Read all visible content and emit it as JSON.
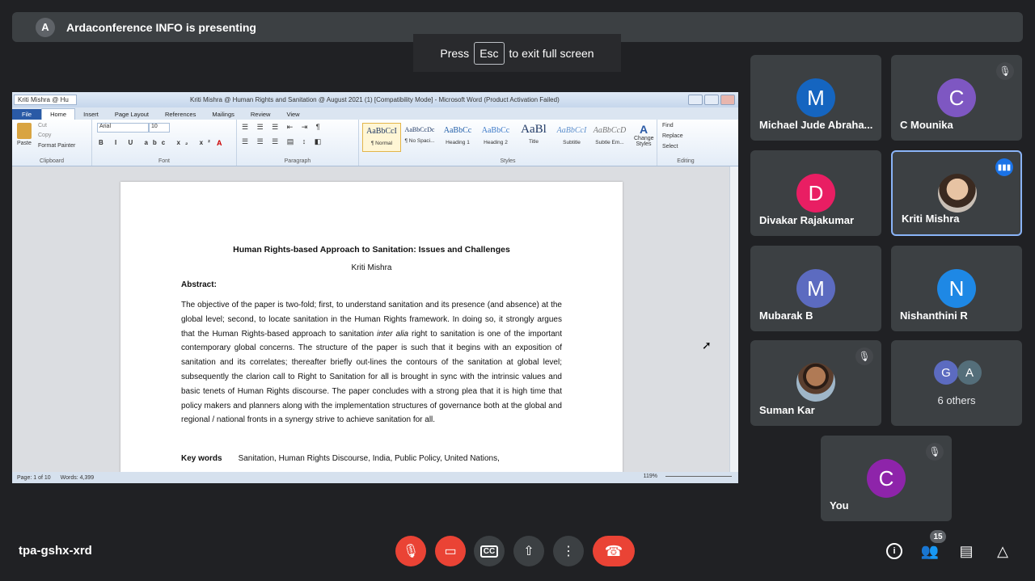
{
  "banner": {
    "avatar_letter": "A",
    "text": "Ardaconference INFO is presenting"
  },
  "fullscreen_hint": {
    "before": "Press",
    "key": "Esc",
    "after": "to exit full screen"
  },
  "word": {
    "doc_tab": "Kriti Mishra @ Hu",
    "title": "Kriti Mishra @ Human Rights and Sanitation @ August 2021 (1) [Compatibility Mode] - Microsoft Word (Product Activation Failed)",
    "tabs": [
      "File",
      "Home",
      "Insert",
      "Page Layout",
      "References",
      "Mailings",
      "Review",
      "View"
    ],
    "clipboard": {
      "paste": "Paste",
      "cut": "Cut",
      "copy": "Copy",
      "format_painter": "Format Painter",
      "group": "Clipboard"
    },
    "font": {
      "name": "Arial",
      "size": "10",
      "group": "Font"
    },
    "paragraph_group": "Paragraph",
    "styles": [
      {
        "sample": "AaBbCcI",
        "name": "¶ Normal"
      },
      {
        "sample": "AaBbCcDc",
        "name": "¶ No Spaci..."
      },
      {
        "sample": "AaBbCc",
        "name": "Heading 1"
      },
      {
        "sample": "AaBbCc",
        "name": "Heading 2"
      },
      {
        "sample": "AaBl",
        "name": "Title"
      },
      {
        "sample": "AaBbCcI",
        "name": "Subtitle"
      },
      {
        "sample": "AaBbCcD",
        "name": "Subtle Em..."
      }
    ],
    "styles_group": "Styles",
    "change_styles": "Change Styles",
    "editing": {
      "find": "Find",
      "replace": "Replace",
      "select": "Select",
      "group": "Editing"
    },
    "document": {
      "title": "Human Rights-based Approach to Sanitation: Issues and Challenges",
      "author": "Kriti Mishra",
      "abstract_heading": "Abstract",
      "abstract_before": "The objective of the paper is two-fold; first, to understand sanitation and its presence (and absence) at the global level; second, to locate sanitation in the Human Rights framework. In doing so, it strongly argues that the Human Rights-based approach to sanitation ",
      "abstract_italic": "inter alia",
      "abstract_after": " right to sanitation is one of the important contemporary global concerns. The structure of the paper is such that it begins with an exposition of sanitation and its correlates; thereafter briefly out-lines the contours of the sanitation at global level; subsequently the clarion call to Right to Sanitation for all is brought in sync with the intrinsic values and basic tenets of Human Rights discourse. The paper concludes with a strong plea that it is high time that policy makers and planners along with the implementation structures of governance both at the global and regional / national fronts in a synergy strive to achieve sanitation for all.",
      "keywords_label": "Key words",
      "keywords": "Sanitation, Human Rights Discourse, India, Public Policy, United Nations,"
    },
    "status": {
      "page": "Page: 1 of 10",
      "words": "Words: 4,399",
      "zoom": "119%"
    }
  },
  "participants": [
    {
      "name": "Michael Jude Abraha...",
      "letter": "M",
      "color": "#1565c0",
      "muted": false
    },
    {
      "name": "C Mounika",
      "letter": "C",
      "color": "#7e57c2",
      "muted": true
    },
    {
      "name": "Divakar Rajakumar",
      "letter": "D",
      "color": "#e91e63",
      "muted": false
    },
    {
      "name": "Kriti Mishra",
      "speaking": true
    },
    {
      "name": "Mubarak B",
      "letter": "M",
      "color": "#5c6bc0",
      "muted": false
    },
    {
      "name": "Nishanthini R",
      "letter": "N",
      "color": "#1e88e5",
      "muted": false
    },
    {
      "name": "Suman Kar",
      "muted": true
    },
    {
      "others_letters": [
        "G",
        "A"
      ],
      "others_label": "6 others"
    },
    {
      "name": "You",
      "letter": "C",
      "color": "#8e24aa",
      "muted": true
    }
  ],
  "meeting_code": "tpa-gshx-xrd",
  "people_count": "15",
  "colors": {
    "background": "#202124",
    "tile": "#3c4043",
    "danger": "#ea4335",
    "speaking": "#8ab4f8"
  }
}
